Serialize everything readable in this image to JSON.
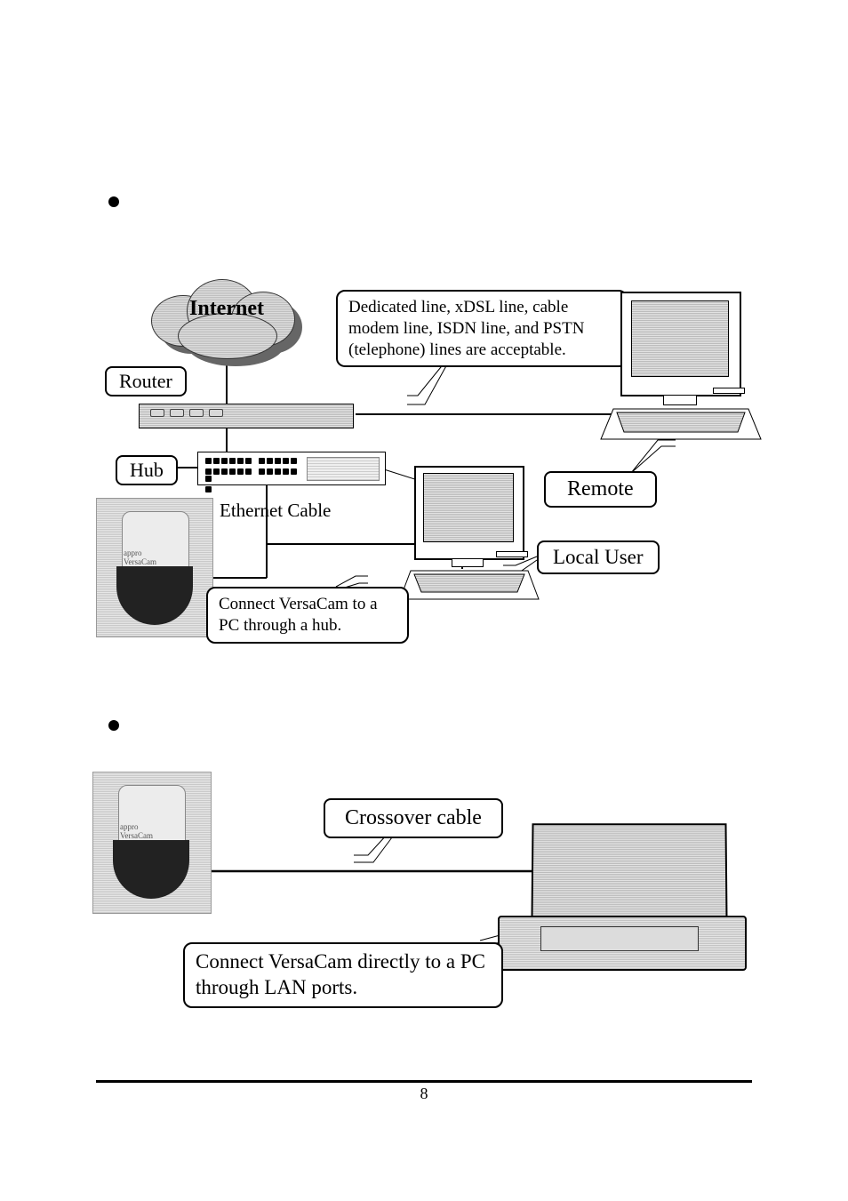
{
  "page_number": "8",
  "diagram1": {
    "internet": "Internet",
    "router": "Router",
    "hub": "Hub",
    "ethernet_cable": "Ethernet Cable",
    "remote": "Remote",
    "local_user": "Local User",
    "connect_hub": "Connect VersaCam to a PC through a hub.",
    "lines_note": "Dedicated line, xDSL line, cable modem line, ISDN line, and PSTN (telephone) lines are acceptable."
  },
  "diagram2": {
    "crossover": "Crossover cable",
    "connect_direct": "Connect VersaCam directly to a PC through LAN ports."
  }
}
